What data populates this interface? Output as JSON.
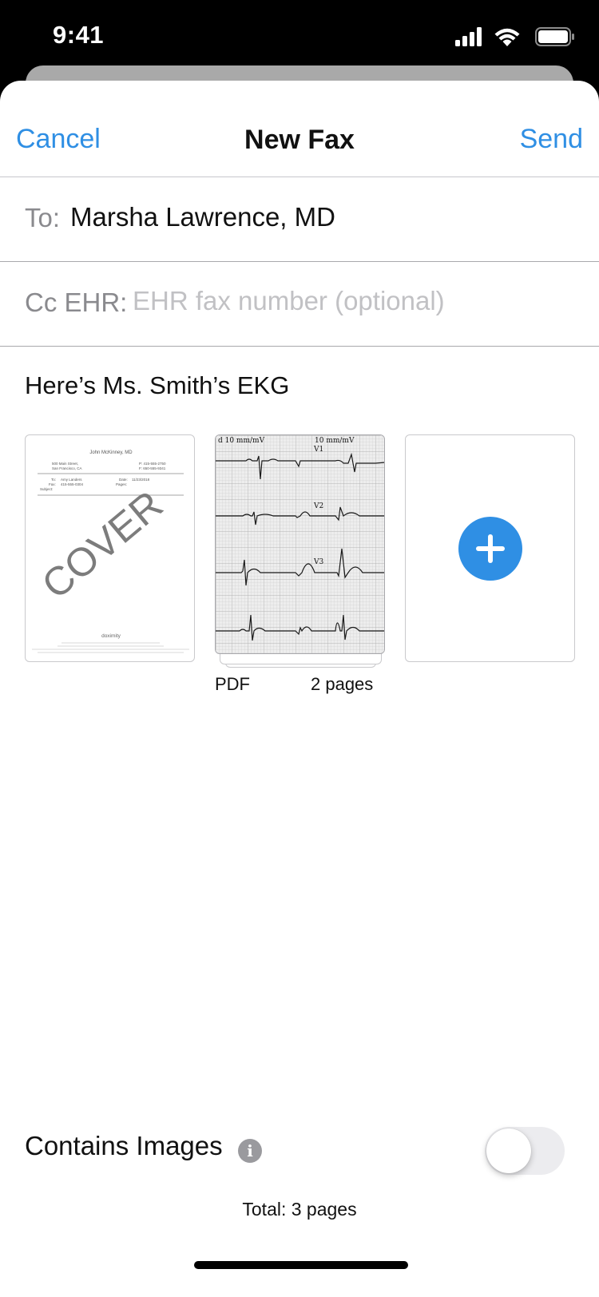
{
  "status_bar": {
    "time": "9:41",
    "icons": [
      "cellular-signal-icon",
      "wifi-icon",
      "battery-icon"
    ]
  },
  "nav": {
    "cancel_label": "Cancel",
    "title": "New Fax",
    "send_label": "Send"
  },
  "to_field": {
    "label": "To:",
    "value": "Marsha Lawrence, MD"
  },
  "cc_field": {
    "label": "Cc EHR:",
    "placeholder": "EHR fax number (optional)",
    "value": ""
  },
  "message": "Here’s Ms. Smith’s EKG",
  "cover_page": {
    "sender": "John McKinney, MD",
    "address_line1": "500 Main Street,",
    "address_line2": "San Francisco, CA",
    "phone": "P: 415-555-2750",
    "fax_num": "F: 650-555-9341",
    "to_label": "To:",
    "to_value": "Amy Landers",
    "fax_label": "Fax:",
    "fax_value": "415-555-0304",
    "date_label": "Date:",
    "date_value": "11/23/2018",
    "pages_label": "Pages:",
    "subject_label": "Subject:",
    "watermark": "COVER",
    "brand": "doximity"
  },
  "ekg_attachment": {
    "header_left": "d 10 mm/mV",
    "header_right": "10 mm/mV",
    "leads": [
      "V1",
      "V2",
      "V3"
    ],
    "type_label": "PDF",
    "pages_label": "2 pages"
  },
  "add_attachment": {
    "icon": "plus-icon"
  },
  "contains_images": {
    "label": "Contains Images",
    "enabled": false
  },
  "total": "Total: 3 pages",
  "colors": {
    "accent": "#2f8fe4",
    "toggle_off": "#ececef",
    "placeholder": "#c1c1c4"
  }
}
